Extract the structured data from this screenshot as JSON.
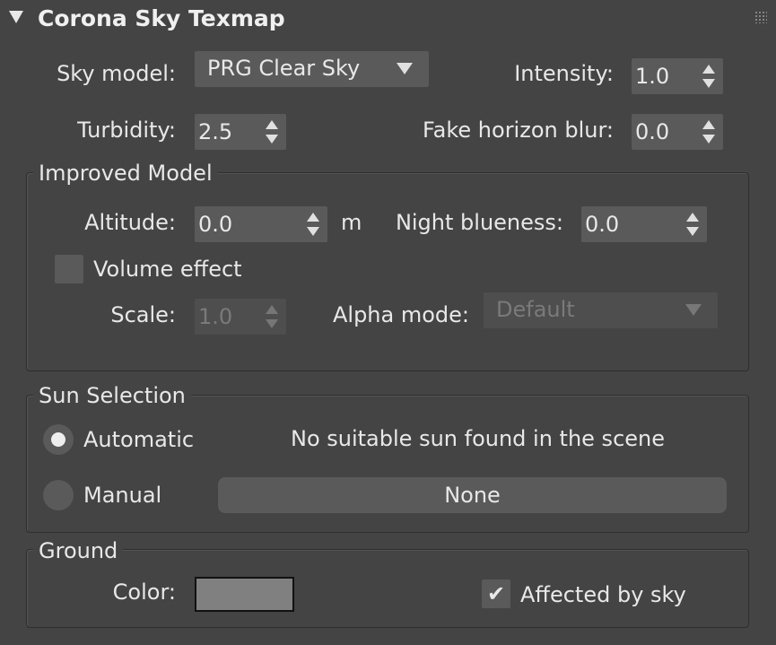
{
  "panel": {
    "title": "Corona Sky Texmap"
  },
  "sky": {
    "model_label": "Sky model:",
    "model_value": "PRG Clear Sky",
    "intensity_label": "Intensity:",
    "intensity_value": "1.0",
    "turbidity_label": "Turbidity:",
    "turbidity_value": "2.5",
    "fake_horizon_label": "Fake horizon blur:",
    "fake_horizon_value": "0.0"
  },
  "improved_model": {
    "title": "Improved Model",
    "altitude_label": "Altitude:",
    "altitude_value": "0.0",
    "altitude_unit": "m",
    "night_blueness_label": "Night blueness:",
    "night_blueness_value": "0.0",
    "volume_effect_label": "Volume effect",
    "volume_effect_checked": false,
    "scale_label": "Scale:",
    "scale_value": "1.0",
    "alpha_mode_label": "Alpha mode:",
    "alpha_mode_value": "Default"
  },
  "sun_selection": {
    "title": "Sun Selection",
    "automatic_label": "Automatic",
    "manual_label": "Manual",
    "selected": "Automatic",
    "status_text": "No suitable sun found in the scene",
    "pick_button_label": "None"
  },
  "ground": {
    "title": "Ground",
    "color_label": "Color:",
    "color_value": "#808080",
    "affected_by_sky_label": "Affected by sky",
    "affected_by_sky_checked": true,
    "check_glyph": "✔"
  }
}
